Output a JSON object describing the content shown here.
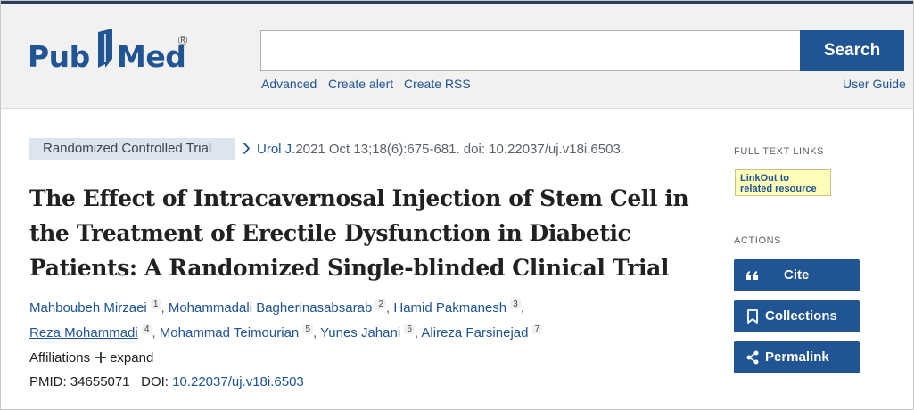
{
  "header": {
    "logo": {
      "text_pub": "Pub",
      "text_med": "Med",
      "registered": "®"
    },
    "search": {
      "value": "",
      "placeholder": "",
      "button": "Search"
    },
    "links": {
      "advanced": "Advanced",
      "create_alert": "Create alert",
      "create_rss": "Create RSS",
      "user_guide": "User Guide"
    }
  },
  "article": {
    "publication_type": "Randomized Controlled Trial",
    "journal": "Urol J.",
    "citation": "2021 Oct 13;18(6):675-681. doi: 10.22037/uj.v18i.6503.",
    "title": "The Effect of Intracavernosal Injection of Stem Cell in the Treatment of Erectile Dysfunction in Diabetic Patients: A Randomized Single-blinded Clinical Trial",
    "authors": [
      {
        "name": "Mahboubeh Mirzaei",
        "num": "1"
      },
      {
        "name": "Mohammadali Bagherinasabsarab",
        "num": "2"
      },
      {
        "name": "Hamid Pakmanesh",
        "num": "3"
      },
      {
        "name": "Reza Mohammadi",
        "num": "4"
      },
      {
        "name": "Mohammad Teimourian",
        "num": "5"
      },
      {
        "name": "Yunes Jahani",
        "num": "6"
      },
      {
        "name": "Alireza Farsinejad",
        "num": "7"
      }
    ],
    "affiliations_label": "Affiliations",
    "expand_label": "expand",
    "pmid_label": "PMID:",
    "pmid": "34655071",
    "doi_label": "DOI:",
    "doi": "10.22037/uj.v18i.6503"
  },
  "sidebar": {
    "full_text_links": "FULL TEXT LINKS",
    "linkout_line1": "LinkOut to",
    "linkout_line2": "related resource",
    "actions": "ACTIONS",
    "cite": "Cite",
    "collections": "Collections",
    "permalink": "Permalink"
  },
  "colors": {
    "brand": "#205493",
    "header_bg": "#f1f1f1",
    "pubtype_bg": "#dce4ef",
    "linkout_bg": "#fffcb8"
  }
}
